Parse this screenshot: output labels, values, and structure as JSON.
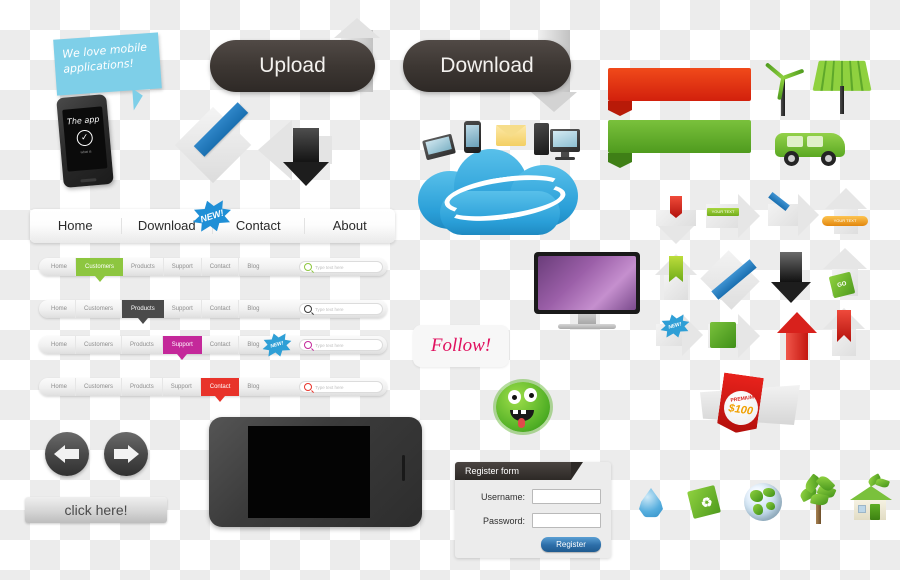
{
  "sticky_note": {
    "line1": "We love mobile",
    "line2": "applications!"
  },
  "phone_portrait": {
    "app_title": "The app",
    "check_icon": "check-icon",
    "caption": "what is"
  },
  "big_buttons": [
    {
      "label": "Upload",
      "icon": "arrow-up-icon"
    },
    {
      "label": "Download",
      "icon": "arrow-down-icon"
    }
  ],
  "main_nav": {
    "items": [
      "Home",
      "Download",
      "Contact",
      "About"
    ],
    "badge": "NEW!"
  },
  "mini_navs": [
    {
      "items": [
        "Home",
        "Customers",
        "Products",
        "Support",
        "Contact",
        "Blog"
      ],
      "active": "Customers",
      "active_color": "#8dc63f",
      "search_placeholder": "Type text here",
      "search_icon_color": "#8dc63f",
      "has_burst": false
    },
    {
      "items": [
        "Home",
        "Customers",
        "Products",
        "Support",
        "Contact",
        "Blog"
      ],
      "active": "Products",
      "active_color": "#4a4a4a",
      "search_placeholder": "Type text here",
      "search_icon_color": "#3a3a3a",
      "has_burst": false
    },
    {
      "items": [
        "Home",
        "Customers",
        "Products",
        "Support",
        "Contact",
        "Blog"
      ],
      "active": "Support",
      "active_color": "#c4289a",
      "search_placeholder": "Type text here",
      "search_icon_color": "#c4289a",
      "has_burst": true,
      "burst_label": "NEW!"
    },
    {
      "items": [
        "Home",
        "Customers",
        "Products",
        "Support",
        "Contact",
        "Blog"
      ],
      "active": "Contact",
      "active_color": "#e8332a",
      "search_placeholder": "Type text here",
      "search_icon_color": "#e8332a",
      "has_burst": false
    }
  ],
  "cloud_graphic": {
    "name": "cloud-computing-graphic",
    "devices": [
      "laptop-icon",
      "smartphone-icon",
      "envelope-icon",
      "desktop-computer-icon"
    ],
    "color": "#2a9fd8"
  },
  "monitor": {
    "name": "desktop-monitor",
    "screen_color": "#9b5fa8"
  },
  "follow_bubble": {
    "label": "Follow!",
    "color": "#e0115f"
  },
  "monster": {
    "name": "green-monster-mascot",
    "color": "#4fae24"
  },
  "register_form": {
    "title": "Register form",
    "username_label": "Username:",
    "password_label": "Password:",
    "username_value": "",
    "password_value": "",
    "submit_label": "Register",
    "submit_color": "#2c6ea8"
  },
  "pager": {
    "prev_icon": "arrow-left-icon",
    "next_icon": "arrow-right-icon",
    "click_here_label": "click here!"
  },
  "phone_landscape": {
    "name": "smartphone-landscape"
  },
  "banners": [
    {
      "name": "ribbon-banner-red",
      "color": "#e8301a"
    },
    {
      "name": "ribbon-banner-green",
      "color": "#62b02b"
    }
  ],
  "eco_top_icons": [
    {
      "name": "wind-turbine-icon"
    },
    {
      "name": "solar-panel-icon"
    },
    {
      "name": "green-car-icon"
    }
  ],
  "arrow_icons": [
    {
      "name": "arrow-down-gray-with-red-tag",
      "tag_color": "#d41f1f",
      "label": ""
    },
    {
      "name": "arrow-right-gray-with-green-ribbon",
      "tag_color": "#8dc63f",
      "label": "YOUR TEXT"
    },
    {
      "name": "arrow-right-gray-with-blue-ribbon",
      "tag_color": "#2f86c8",
      "label": ""
    },
    {
      "name": "arrow-up-gray-with-orange-tag",
      "tag_color": "#f2a32a",
      "label": "YOUR TEXT"
    },
    {
      "name": "arrow-up-gray-with-green-bookmark",
      "tag_color": "#a8d02a",
      "label": ""
    },
    {
      "name": "arrow-diagonal-gray-with-blue-ribbon",
      "tag_color": "#2f86c8",
      "label": ""
    },
    {
      "name": "arrow-down-black",
      "tag_color": "#1d1d1d",
      "label": ""
    },
    {
      "name": "arrow-up-gray-with-green-badge",
      "tag_color": "#6aba22",
      "label": "GO"
    },
    {
      "name": "arrow-right-gray-with-blue-burst",
      "tag_color": "#2f9fd6",
      "label": "NEW!"
    },
    {
      "name": "arrow-right-gray-with-green-square",
      "tag_color": "#62b02b",
      "label": ""
    },
    {
      "name": "arrow-up-red",
      "tag_color": "#d8211c",
      "label": ""
    },
    {
      "name": "arrow-up-gray-with-red-bookmark",
      "tag_color": "#d8211c",
      "label": ""
    }
  ],
  "premium_tag": {
    "name": "premium-price-tag",
    "title": "PREMIUM",
    "price": "$100",
    "color": "#d8211c"
  },
  "eco_bottom_icons": [
    {
      "name": "water-drop-icon"
    },
    {
      "name": "recycle-tag-icon"
    },
    {
      "name": "earth-globe-icon"
    },
    {
      "name": "tree-icon"
    },
    {
      "name": "eco-house-icon"
    }
  ]
}
